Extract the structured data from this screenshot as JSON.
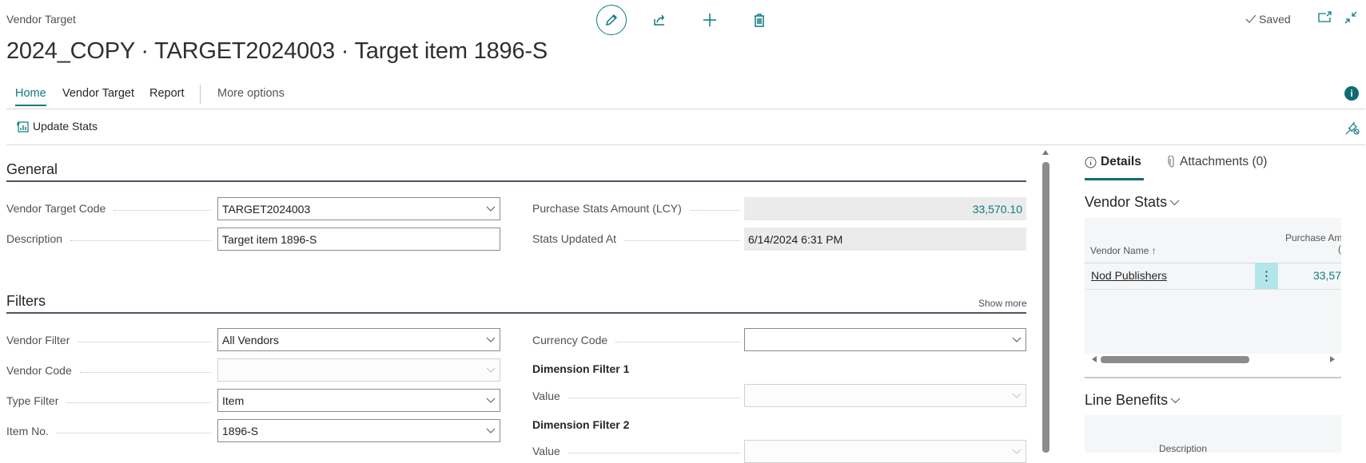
{
  "header": {
    "caption": "Vendor Target",
    "title": "2024_COPY · TARGET2024003 · Target item 1896-S",
    "saved_label": "Saved",
    "icons": [
      "edit-icon",
      "share-icon",
      "new-icon",
      "delete-icon",
      "open-new-window-icon",
      "collapse-icon"
    ]
  },
  "tabs": [
    {
      "label": "Home",
      "active": true
    },
    {
      "label": "Vendor Target",
      "active": false
    },
    {
      "label": "Report",
      "active": false
    },
    {
      "label": "More options",
      "active": false
    }
  ],
  "actions": {
    "update_stats": "Update Stats"
  },
  "general": {
    "title": "General",
    "vendor_target_code": {
      "label": "Vendor Target Code",
      "value": "TARGET2024003"
    },
    "description": {
      "label": "Description",
      "value": "Target item 1896-S"
    },
    "purchase_stats_amount": {
      "label": "Purchase Stats Amount (LCY)",
      "value": "33,570.10"
    },
    "stats_updated_at": {
      "label": "Stats Updated At",
      "value": "6/14/2024 6:31 PM"
    }
  },
  "filters": {
    "title": "Filters",
    "show_more": "Show more",
    "vendor_filter": {
      "label": "Vendor Filter",
      "value": "All Vendors"
    },
    "vendor_code": {
      "label": "Vendor Code",
      "value": ""
    },
    "type_filter": {
      "label": "Type Filter",
      "value": "Item"
    },
    "item_no": {
      "label": "Item No.",
      "value": "1896-S"
    },
    "currency_code": {
      "label": "Currency Code",
      "value": ""
    },
    "dimension_filter_1": {
      "title": "Dimension Filter 1",
      "value_label": "Value",
      "value": ""
    },
    "dimension_filter_2": {
      "title": "Dimension Filter 2",
      "value_label": "Value",
      "value": ""
    }
  },
  "factbox": {
    "tabs": [
      {
        "label": "Details",
        "icon": "info-icon",
        "active": true
      },
      {
        "label": "Attachments (0)",
        "icon": "paperclip-icon",
        "active": false
      }
    ],
    "vendor_stats": {
      "title": "Vendor Stats",
      "columns": [
        "Vendor Name",
        "Purchase Am"
      ],
      "column2_line2": "(",
      "sort_indicator": "↑",
      "rows": [
        {
          "vendor_name": "Nod Publishers",
          "amount": "33,57"
        }
      ]
    },
    "line_benefits": {
      "title": "Line Benefits",
      "columns": [
        "Description"
      ]
    }
  },
  "colors": {
    "accent": "#0e7a80",
    "readonly_bg": "#ebebeb",
    "selected_cell": "#b2e6ea"
  }
}
